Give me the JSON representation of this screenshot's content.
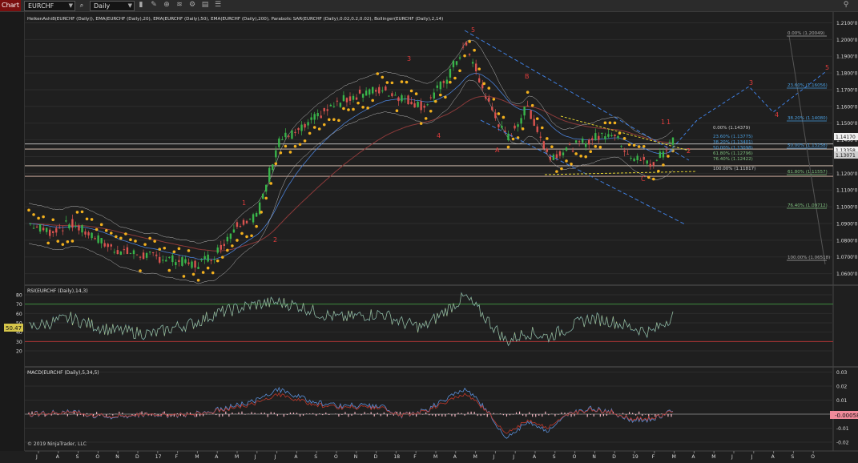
{
  "toolbar": {
    "chart_tab": "Chart",
    "instrument": "EURCHF",
    "period": "Daily",
    "icons": [
      "search-icon",
      "bar-style-icon",
      "drawing-tools-icon",
      "zoom-icon",
      "indicators-icon",
      "strategies-icon",
      "templates-icon",
      "properties-icon",
      "pin-icon"
    ]
  },
  "price_panel": {
    "indicator_label": "HeikenAshi8(EURCHF (Daily)), EMA(EURCHF (Daily),20), EMA(EURCHF (Daily),50), EMA(EURCHF (Daily),200), Parabolic SAR(EURCHF (Daily),0.02,0.2,0.02), Bollinger(EURCHF (Daily),2,14)",
    "y_ticks": [
      "1.2100'0",
      "1.2000'0",
      "1.1900'0",
      "1.1800'0",
      "1.1700'0",
      "1.1600'0",
      "1.1500'0",
      "1.1400'0",
      "1.1300'0",
      "1.1200'0",
      "1.1100'0",
      "1.1000'0",
      "1.0900'0",
      "1.0800'0",
      "1.0700'0",
      "1.0600'0"
    ],
    "price_labels": [
      "1.14170",
      "1.13358",
      "1.13071"
    ],
    "wave_labels": [
      "1",
      "2",
      "3",
      "4",
      "5",
      "A",
      "B",
      "C",
      "1",
      "2",
      "3",
      "4",
      "5",
      "1",
      "2"
    ],
    "fib_upper": [
      "0.00% (1.20049)",
      "23.60% (1.16056)",
      "38.20% (1.14080)",
      "50.00% (1.13258)",
      "61.80% (1.11557)",
      "76.40% (1.09712)",
      "100.00% (1.06518)"
    ],
    "fib_lower": [
      "0.00% (1.14379)",
      "23.60% (1.13775)",
      "38.20% (1.13401)",
      "50.00% (1.13098)",
      "61.80% (1.12796)",
      "76.40% (1.12422)",
      "100.00% (1.11817)"
    ]
  },
  "rsi_panel": {
    "label": "RSI(EURCHF (Daily),14,3)",
    "y_ticks": [
      "80",
      "70",
      "60",
      "50",
      "40",
      "30",
      "20"
    ],
    "current": "50.47"
  },
  "macd_panel": {
    "label": "MACD(EURCHF (Daily),5,34,5)",
    "y_ticks": [
      "0.03",
      "0.02",
      "0.01",
      "0",
      "-0.01",
      "-0.02"
    ],
    "current": "-0.00058"
  },
  "copyright": "© 2019 NinjaTrader, LLC",
  "x_axis_labels": [
    "J",
    "A",
    "S",
    "O",
    "N",
    "D",
    "17",
    "F",
    "M",
    "A",
    "M",
    "J",
    "J",
    "A",
    "S",
    "O",
    "N",
    "D",
    "18",
    "F",
    "M",
    "A",
    "M",
    "J",
    "J",
    "A",
    "S",
    "O",
    "N",
    "D",
    "19",
    "F",
    "M",
    "A",
    "M",
    "J",
    "J",
    "A",
    "S",
    "O"
  ],
  "colors": {
    "background": "#1f1f1f",
    "candle_up": "#39b54a",
    "candle_down": "#d9534f",
    "sar": "#f2b01e",
    "ema20": "#4a7fd4",
    "ema200": "#8c3a3a",
    "wave_label": "#e03c3c",
    "projection": "#3f7fe0"
  },
  "chart_data": {
    "type": "line",
    "title": "EURCHF Daily",
    "x": [
      "J",
      "A",
      "S",
      "O",
      "N",
      "D",
      "17",
      "F",
      "M",
      "A",
      "M",
      "J",
      "J",
      "A",
      "S",
      "O",
      "N",
      "D",
      "18",
      "F",
      "M",
      "A",
      "M",
      "J",
      "J",
      "A",
      "S",
      "O",
      "N",
      "D",
      "19",
      "F"
    ],
    "series": [
      {
        "name": "EURCHF",
        "values": [
          1.09,
          1.085,
          1.09,
          1.083,
          1.075,
          1.072,
          1.07,
          1.068,
          1.065,
          1.072,
          1.09,
          1.095,
          1.14,
          1.145,
          1.155,
          1.163,
          1.168,
          1.17,
          1.165,
          1.16,
          1.175,
          1.197,
          1.165,
          1.14,
          1.16,
          1.13,
          1.135,
          1.14,
          1.145,
          1.13,
          1.125,
          1.14
        ]
      }
    ],
    "ylim": [
      1.055,
      1.215
    ],
    "rsi": [
      45,
      50,
      55,
      48,
      42,
      40,
      38,
      45,
      50,
      60,
      65,
      70,
      72,
      68,
      60,
      55,
      58,
      60,
      50,
      45,
      62,
      78,
      55,
      30,
      40,
      35,
      45,
      55,
      52,
      45,
      40,
      58
    ],
    "macd": [
      0.0,
      0.001,
      0.002,
      -0.001,
      -0.002,
      -0.001,
      0.0,
      -0.001,
      0.0,
      0.003,
      0.006,
      0.01,
      0.018,
      0.012,
      0.008,
      0.006,
      0.006,
      0.005,
      -0.001,
      0.002,
      0.01,
      0.018,
      0.004,
      -0.018,
      -0.005,
      -0.012,
      0.0,
      0.004,
      0.002,
      -0.004,
      -0.004,
      0.003
    ],
    "grid": true
  }
}
